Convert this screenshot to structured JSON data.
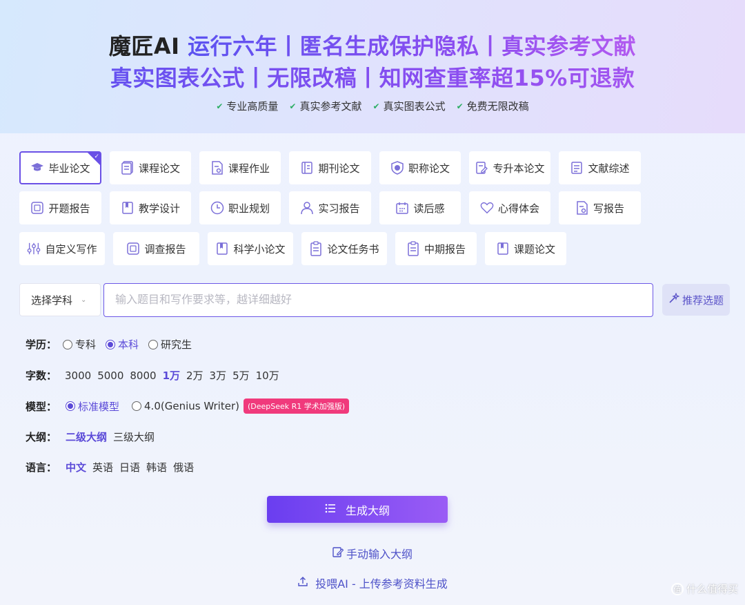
{
  "hero": {
    "line1_brand": "魔匠AI",
    "line1_rest": " 运行六年丨匿名生成保护隐私丨真实参考文献",
    "line2": "真实图表公式丨无限改稿丨知网查重率超15%可退款"
  },
  "features": [
    "专业高质量",
    "真实参考文献",
    "真实图表公式",
    "免费无限改稿"
  ],
  "paper_types": [
    {
      "label": "毕业论文",
      "icon": "graduation-cap-icon",
      "active": true
    },
    {
      "label": "课程论文",
      "icon": "document-stack-icon"
    },
    {
      "label": "课程作业",
      "icon": "document-search-icon"
    },
    {
      "label": "期刊论文",
      "icon": "journal-icon"
    },
    {
      "label": "职称论文",
      "icon": "shield-badge-icon"
    },
    {
      "label": "专升本论文",
      "icon": "document-edit-icon"
    },
    {
      "label": "文献综述",
      "icon": "document-list-icon"
    },
    {
      "label": "开题报告",
      "icon": "report-icon"
    },
    {
      "label": "教学设计",
      "icon": "book-icon"
    },
    {
      "label": "职业规划",
      "icon": "clock-icon"
    },
    {
      "label": "实习报告",
      "icon": "person-icon"
    },
    {
      "label": "读后感",
      "icon": "calendar-icon"
    },
    {
      "label": "心得体会",
      "icon": "heart-icon"
    },
    {
      "label": "写报告",
      "icon": "document-search-icon"
    },
    {
      "label": "自定义写作",
      "icon": "sliders-icon"
    },
    {
      "label": "调查报告",
      "icon": "report-icon"
    },
    {
      "label": "科学小论文",
      "icon": "book-icon"
    },
    {
      "label": "论文任务书",
      "icon": "clipboard-icon"
    },
    {
      "label": "中期报告",
      "icon": "clipboard-icon"
    },
    {
      "label": "课题论文",
      "icon": "book-icon"
    }
  ],
  "subject_select": {
    "label": "选择学科"
  },
  "topic": {
    "placeholder": "输入题目和写作要求等，越详细越好"
  },
  "recommend_button": "推荐选题",
  "options": {
    "education": {
      "label": "学历：",
      "choices": [
        "专科",
        "本科",
        "研究生"
      ],
      "selected": "本科"
    },
    "word_count": {
      "label": "字数：",
      "choices": [
        "3000",
        "5000",
        "8000",
        "1万",
        "2万",
        "3万",
        "5万",
        "10万"
      ],
      "selected": "1万"
    },
    "model": {
      "label": "模型：",
      "choices": [
        "标准模型",
        "4.0(Genius Writer)"
      ],
      "selected": "标准模型",
      "badge": "(DeepSeek R1 学术加强版)"
    },
    "outline": {
      "label": "大纲：",
      "choices": [
        "二级大纲",
        "三级大纲"
      ],
      "selected": "二级大纲"
    },
    "language": {
      "label": "语言：",
      "choices": [
        "中文",
        "英语",
        "日语",
        "韩语",
        "俄语"
      ],
      "selected": "中文"
    }
  },
  "generate_button": "生成大纲",
  "manual_outline_link": "手动输入大纲",
  "upload_link": "投喂AI - 上传参考资料生成",
  "watermark": "什么值得买",
  "colors": {
    "accent": "#6a50e6",
    "badge": "#f03a7c",
    "check": "#2cae64",
    "link": "#4e52c8"
  }
}
